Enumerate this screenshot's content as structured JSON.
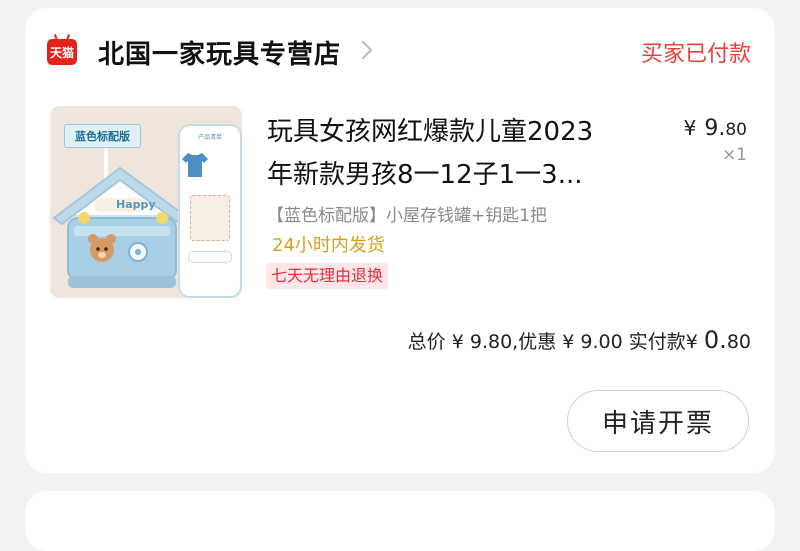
{
  "store": {
    "logo_text": "天猫",
    "name": "北国一家玩具专营店",
    "chevron_icon": "chevron-right-icon",
    "status": "买家已付款"
  },
  "product": {
    "image_tag": "蓝色标配版",
    "image_sign": "Happy",
    "image_inset_label": "产品清单",
    "title_line1": "玩具女孩网红爆款儿童2023",
    "title_line2": "年新款男孩8一12子1一3...",
    "price_symbol": "¥",
    "price_int": "9.",
    "price_dec": "80",
    "quantity": "×1",
    "spec": "【蓝色标配版】小屋存钱罐+钥匙1把",
    "delivery": "24小时内发货",
    "return_policy": "七天无理由退换"
  },
  "summary": {
    "total_label": "总价",
    "total_value": "¥ 9.80",
    "discount_label": ",优惠",
    "discount_value": "¥ 9.00",
    "paid_label": "实付款",
    "paid_symbol": "¥",
    "paid_int": "0.",
    "paid_dec": "80"
  },
  "actions": {
    "invoice_label": "申请开票"
  },
  "colors": {
    "accent_red": "#e8403a",
    "tmall_red": "#e2231a",
    "delivery_gold": "#d6a11c",
    "return_tag_bg": "#fde6e7"
  }
}
